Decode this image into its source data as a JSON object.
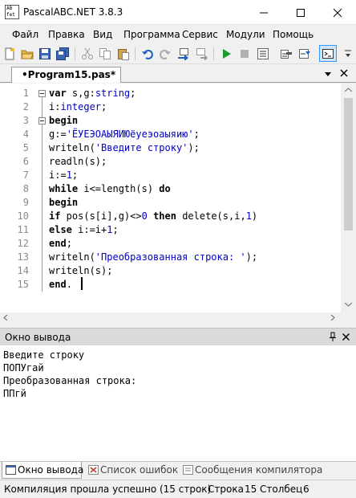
{
  "window": {
    "title": "PascalABC.NET 3.8.3",
    "app_icon_text": "AB\nfet",
    "icons": [
      "minimize-icon",
      "maximize-icon",
      "close-icon"
    ]
  },
  "menu": [
    "Файл",
    "Правка",
    "Вид",
    "Программа",
    "Сервис",
    "Модули",
    "Помощь"
  ],
  "toolbar": {
    "icons": [
      "new-file-icon",
      "open-file-icon",
      "save-icon",
      "save-all-icon",
      "cut-icon",
      "copy-icon",
      "paste-icon",
      "undo-icon",
      "redo-icon",
      "step-icon",
      "step-over-icon",
      "run-icon",
      "stop-icon",
      "compile-icon",
      "format-icon",
      "output-window-icon",
      "overflow-icon"
    ]
  },
  "editor": {
    "tab_label": "•Program15.pas*",
    "line_numbers": [
      "1",
      "2",
      "3",
      "4",
      "5",
      "6",
      "7",
      "8",
      "9",
      "10",
      "11",
      "12",
      "13",
      "14",
      "15"
    ],
    "lines": [
      [
        {
          "t": "var",
          "c": "kw"
        },
        {
          "t": " s,g:",
          "c": ""
        },
        {
          "t": "string",
          "c": "typ"
        },
        {
          "t": ";",
          "c": ""
        }
      ],
      [
        {
          "t": "i:",
          "c": ""
        },
        {
          "t": "integer",
          "c": "typ"
        },
        {
          "t": ";",
          "c": ""
        }
      ],
      [
        {
          "t": "begin",
          "c": "kw"
        }
      ],
      [
        {
          "t": "g:=",
          "c": ""
        },
        {
          "t": "'ЁУЕЭОАЫЯИЮёуеэоаыяию'",
          "c": "str"
        },
        {
          "t": ";",
          "c": ""
        }
      ],
      [
        {
          "t": "writeln(",
          "c": ""
        },
        {
          "t": "'Введите строку'",
          "c": "str"
        },
        {
          "t": ");",
          "c": ""
        }
      ],
      [
        {
          "t": "readln(s);",
          "c": ""
        }
      ],
      [
        {
          "t": "i:=",
          "c": ""
        },
        {
          "t": "1",
          "c": "str"
        },
        {
          "t": ";",
          "c": ""
        }
      ],
      [
        {
          "t": "while",
          "c": "kw"
        },
        {
          "t": " i<=length(s) ",
          "c": ""
        },
        {
          "t": "do",
          "c": "kw"
        }
      ],
      [
        {
          "t": "begin",
          "c": "kw"
        }
      ],
      [
        {
          "t": "if",
          "c": "kw"
        },
        {
          "t": " pos(s[i],g)<>",
          "c": ""
        },
        {
          "t": "0",
          "c": "str"
        },
        {
          "t": " ",
          "c": ""
        },
        {
          "t": "then",
          "c": "kw"
        },
        {
          "t": " delete(s,i,",
          "c": ""
        },
        {
          "t": "1",
          "c": "str"
        },
        {
          "t": ")",
          "c": ""
        }
      ],
      [
        {
          "t": "else",
          "c": "kw"
        },
        {
          "t": " i:=i+",
          "c": ""
        },
        {
          "t": "1",
          "c": "str"
        },
        {
          "t": ";",
          "c": ""
        }
      ],
      [
        {
          "t": "end",
          "c": "kw"
        },
        {
          "t": ";",
          "c": ""
        }
      ],
      [
        {
          "t": "writeln(",
          "c": ""
        },
        {
          "t": "'Преобразованная строка: '",
          "c": "str"
        },
        {
          "t": ");",
          "c": ""
        }
      ],
      [
        {
          "t": "writeln(s);",
          "c": ""
        }
      ],
      [
        {
          "t": "end",
          "c": "kw"
        },
        {
          "t": ".",
          "c": ""
        }
      ]
    ]
  },
  "output_panel": {
    "title": "Окно вывода",
    "lines": [
      "Введите строку",
      "ПОПУгай",
      "Преобразованная строка:",
      "ППгй"
    ]
  },
  "bottom_tabs": [
    "Окно вывода",
    "Список ошибок",
    "Сообщения компилятора"
  ],
  "status": {
    "message": "Компиляция прошла успешно (15 строк)",
    "line_label": "Строка",
    "line_value": "15",
    "col_label": "Столбец",
    "col_value": "6"
  }
}
